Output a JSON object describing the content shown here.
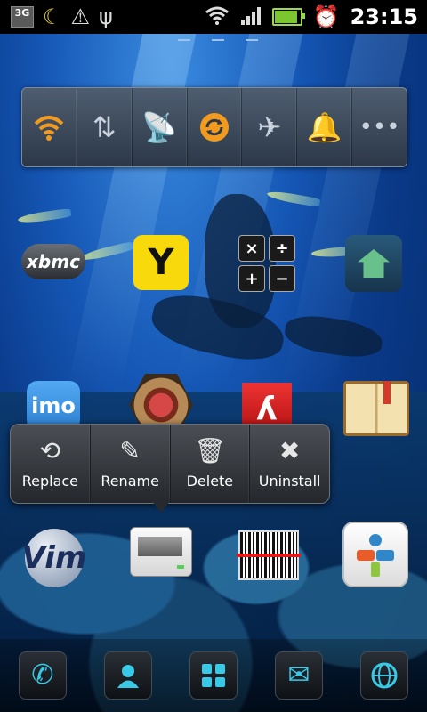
{
  "status_bar": {
    "network_badge": "3G",
    "time": "23:15",
    "battery_level": 0.85,
    "icons": [
      "3g-icon",
      "moon-icon",
      "warning-icon",
      "usb-icon",
      "wifi-icon",
      "signal-icon",
      "battery-charging-icon",
      "alarm-icon"
    ]
  },
  "power_widget": {
    "items": [
      {
        "name": "wifi-toggle",
        "icon": "wifi-icon",
        "state": "on"
      },
      {
        "name": "data-toggle",
        "icon": "data-arrows-icon",
        "state": "off"
      },
      {
        "name": "gps-toggle",
        "icon": "satellite-icon",
        "state": "off"
      },
      {
        "name": "sync-toggle",
        "icon": "sync-icon",
        "state": "on"
      },
      {
        "name": "airplane-toggle",
        "icon": "airplane-icon",
        "state": "off"
      },
      {
        "name": "sound-toggle",
        "icon": "bell-icon",
        "state": "on"
      },
      {
        "name": "more-button",
        "icon": "more-icon",
        "state": "off"
      }
    ],
    "accent_color": "#f29a1d"
  },
  "apps": {
    "xbmc_text": "xbmc",
    "yp_glyph": "Y",
    "calc_keys": [
      "×",
      "÷",
      "+",
      "−"
    ],
    "imo_text": "imo",
    "vim_text": "Vim"
  },
  "context_menu": {
    "items": [
      {
        "label": "Replace",
        "icon": "replace-icon"
      },
      {
        "label": "Rename",
        "icon": "edit-icon"
      },
      {
        "label": "Delete",
        "icon": "trash-icon"
      },
      {
        "label": "Uninstall",
        "icon": "close-icon"
      }
    ]
  },
  "dock": {
    "items": [
      {
        "name": "phone",
        "icon": "phone-icon"
      },
      {
        "name": "contacts",
        "icon": "contacts-icon"
      },
      {
        "name": "app-drawer",
        "icon": "grid-icon"
      },
      {
        "name": "messages",
        "icon": "envelope-icon"
      },
      {
        "name": "browser",
        "icon": "globe-icon"
      }
    ],
    "accent_color": "#38c9e6"
  }
}
